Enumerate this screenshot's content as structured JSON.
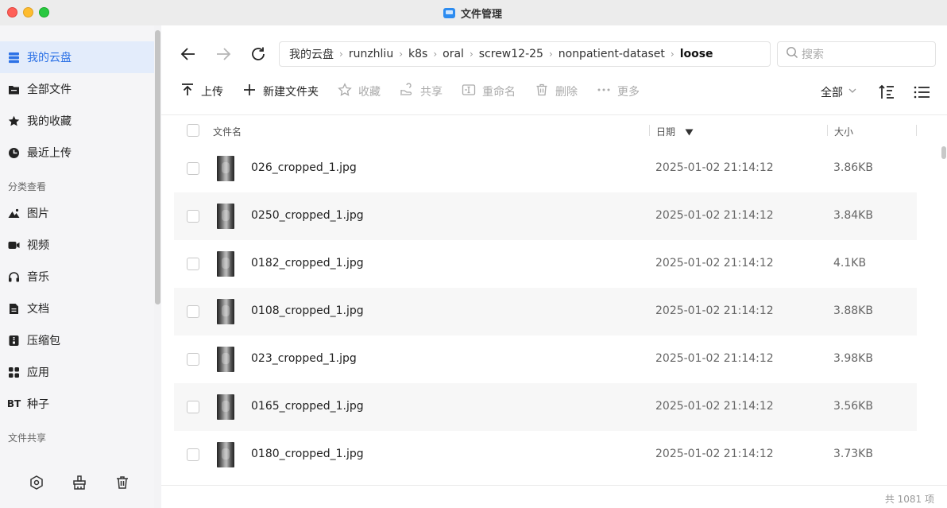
{
  "window": {
    "title": "文件管理",
    "accent": "#2d72e6"
  },
  "sidebar": {
    "items": [
      {
        "label": "我的云盘",
        "icon": "cloud-stack-icon",
        "active": true
      },
      {
        "label": "全部文件",
        "icon": "folder-icon"
      },
      {
        "label": "我的收藏",
        "icon": "star-icon"
      },
      {
        "label": "最近上传",
        "icon": "clock-icon"
      }
    ],
    "section_category": "分类查看",
    "categories": [
      {
        "label": "图片",
        "icon": "mountain-image-icon"
      },
      {
        "label": "视频",
        "icon": "video-camera-icon"
      },
      {
        "label": "音乐",
        "icon": "headphones-icon"
      },
      {
        "label": "文档",
        "icon": "document-icon"
      },
      {
        "label": "压缩包",
        "icon": "archive-icon"
      },
      {
        "label": "应用",
        "icon": "apps-grid-icon"
      },
      {
        "label": "种子",
        "icon": "bt-icon",
        "glyph": "BT"
      }
    ],
    "section_share": "文件共享",
    "bottom_icons": [
      "settings-hex-icon",
      "cleanup-brush-icon",
      "trash-icon"
    ]
  },
  "nav": {
    "breadcrumb": [
      "我的云盘",
      "runzhliu",
      "k8s",
      "oral",
      "screw12-25",
      "nonpatient-dataset",
      "loose"
    ],
    "search_placeholder": "搜索"
  },
  "toolbar": {
    "upload": "上传",
    "new_folder": "新建文件夹",
    "favorite": "收藏",
    "share": "共享",
    "rename": "重命名",
    "delete": "删除",
    "more": "更多",
    "filter": "全部"
  },
  "table": {
    "col_name": "文件名",
    "col_date": "日期",
    "col_size": "大小",
    "rows": [
      {
        "name": "026_cropped_1.jpg",
        "date": "2025-01-02 21:14:12",
        "size": "3.86KB"
      },
      {
        "name": "0250_cropped_1.jpg",
        "date": "2025-01-02 21:14:12",
        "size": "3.84KB"
      },
      {
        "name": "0182_cropped_1.jpg",
        "date": "2025-01-02 21:14:12",
        "size": "4.1KB"
      },
      {
        "name": "0108_cropped_1.jpg",
        "date": "2025-01-02 21:14:12",
        "size": "3.88KB"
      },
      {
        "name": "023_cropped_1.jpg",
        "date": "2025-01-02 21:14:12",
        "size": "3.98KB"
      },
      {
        "name": "0165_cropped_1.jpg",
        "date": "2025-01-02 21:14:12",
        "size": "3.56KB"
      },
      {
        "name": "0180_cropped_1.jpg",
        "date": "2025-01-02 21:14:12",
        "size": "3.73KB"
      }
    ],
    "footer_count": "共 1081 项"
  }
}
